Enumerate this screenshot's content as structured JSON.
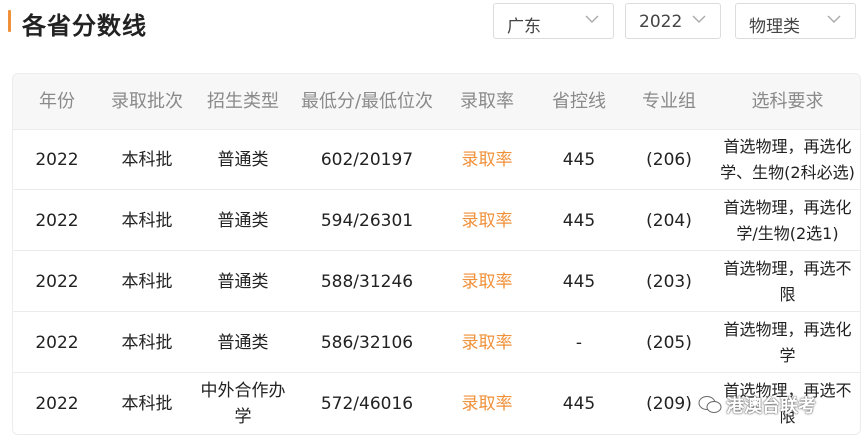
{
  "page": {
    "title": "各省分数线"
  },
  "filters": {
    "province": "广东",
    "year": "2022",
    "subject_type": "物理类"
  },
  "table": {
    "headers": [
      "年份",
      "录取批次",
      "招生类型",
      "最低分/最低位次",
      "录取率",
      "省控线",
      "专业组",
      "选科要求"
    ],
    "rows": [
      {
        "year": "2022",
        "batch": "本科批",
        "type_l1": "普通类",
        "type_l2": "",
        "min": "602/20197",
        "rate": "录取率",
        "control": "445",
        "group": "(206)",
        "req_l1": "首选物理，再选化",
        "req_l2": "学、生物(2科必选)"
      },
      {
        "year": "2022",
        "batch": "本科批",
        "type_l1": "普通类",
        "type_l2": "",
        "min": "594/26301",
        "rate": "录取率",
        "control": "445",
        "group": "(204)",
        "req_l1": "首选物理，再选化",
        "req_l2": "学/生物(2选1)"
      },
      {
        "year": "2022",
        "batch": "本科批",
        "type_l1": "普通类",
        "type_l2": "",
        "min": "588/31246",
        "rate": "录取率",
        "control": "445",
        "group": "(203)",
        "req_l1": "首选物理，再选不",
        "req_l2": "限"
      },
      {
        "year": "2022",
        "batch": "本科批",
        "type_l1": "普通类",
        "type_l2": "",
        "min": "586/32106",
        "rate": "录取率",
        "control": "-",
        "group": "(205)",
        "req_l1": "首选物理，再选化",
        "req_l2": "学"
      },
      {
        "year": "2022",
        "batch": "本科批",
        "type_l1": "中外合作办",
        "type_l2": "学",
        "min": "572/46016",
        "rate": "录取率",
        "control": "445",
        "group": "(209)",
        "req_l1": "首选物理，再选不",
        "req_l2": "限"
      }
    ]
  },
  "watermark": {
    "text": "港澳台联考"
  },
  "colors": {
    "accent": "#f0913a"
  }
}
